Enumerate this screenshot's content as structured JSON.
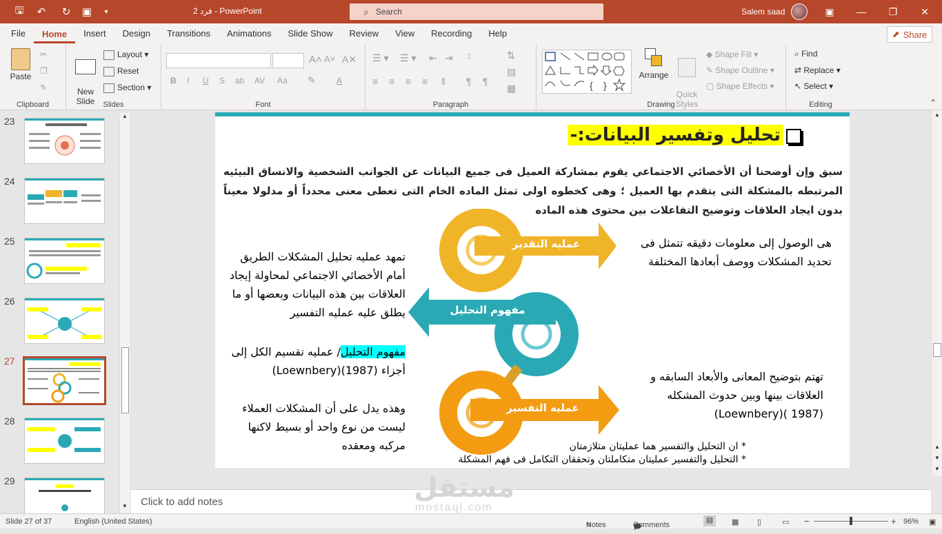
{
  "titlebar": {
    "doc_title": "فرد 2  -  PowerPoint",
    "search_label": "Search",
    "user_name": "Salem saad"
  },
  "tabs": [
    "File",
    "Home",
    "Insert",
    "Design",
    "Transitions",
    "Animations",
    "Slide Show",
    "Review",
    "View",
    "Recording",
    "Help"
  ],
  "active_tab": "Home",
  "share_label": "Share",
  "ribbon": {
    "clipboard": {
      "label": "Clipboard",
      "paste": "Paste"
    },
    "slides": {
      "label": "Slides",
      "new_slide": "New\nSlide",
      "layout": "Layout",
      "reset": "Reset",
      "section": "Section"
    },
    "font": {
      "label": "Font",
      "buttons": [
        "B",
        "I",
        "U",
        "S",
        "ab",
        "AV",
        "Aa",
        "A"
      ]
    },
    "paragraph": {
      "label": "Paragraph"
    },
    "drawing": {
      "label": "Drawing",
      "arrange": "Arrange",
      "quick_styles": "Quick\nStyles",
      "shape_fill": "Shape Fill",
      "shape_outline": "Shape Outline",
      "shape_effects": "Shape Effects"
    },
    "editing": {
      "label": "Editing",
      "find": "Find",
      "replace": "Replace",
      "select": "Select"
    }
  },
  "thumbnails": [
    {
      "num": "23",
      "selected": false
    },
    {
      "num": "24",
      "selected": false
    },
    {
      "num": "25",
      "selected": false
    },
    {
      "num": "26",
      "selected": false
    },
    {
      "num": "27",
      "selected": true
    },
    {
      "num": "28",
      "selected": false
    },
    {
      "num": "29",
      "selected": false
    }
  ],
  "slide": {
    "title": "تحليل وتفسير البيانات:-",
    "paragraph": "سبق وإن أوضحنا أن الأخصائي الاجتماعي يقوم بمشاركة العميل فى جميع البيانات عن الجوانب الشخصية والانساق البيئيه المرتبطه بالمشكلة التى يتقدم بها العميل ؛ وهى كخطوه اولى تمثل الماده الخام التى تعطى معنى محدداً أو مدلولا معيناً بدون ايجاد العلاقات وتوضيح التفاعلات بين محتوى هذه الماده",
    "arrow1": "عمليه التقدير",
    "arrow2": "مفهوم التحليل",
    "arrow3": "عمليه التفسير",
    "right_top": "هى الوصول إلى معلومات دقيقه تتمثل فى تحديد المشكلات ووصف أبعادها المختلفة",
    "left_top": "تمهد عمليه تحليل المشكلات الطريق أمام الأخصائي الاجتماعي لمحاولة إيجاد العلاقات بين هذه البيانات وبعضها أو ما يطلق عليه عمليه التفسير",
    "left_mid_hl": "مفهوم التحليل",
    "left_mid_rest": "/ عمليه تقسيم الكل إلى أجزاء (1987)(Loewnbery)",
    "left_bottom": "وهذه يدل على أن المشكلات العملاء ليست من نوع واحد أو بسيط لاكنها مركبه ومعقده",
    "right_bottom": "تهتم بتوضيح المعانى والأبعاد السابقه و العلاقات بينها وبين حدوث المشكله (1987 )(Loewnbery)",
    "note1": "* ان التحليل والتفسير  هما عمليتان متلازمتان",
    "note2": "* التحليل والتفسير  عمليتان متكاملتان وتحققان التكامل فى فهم المشكلة"
  },
  "notes_placeholder": "Click to add notes",
  "status": {
    "slide_info": "Slide 27 of 37",
    "language": "English (United States)",
    "notes": "Notes",
    "comments": "Comments",
    "zoom": "96%"
  },
  "watermark": {
    "arabic": "مستقل",
    "latin": "mostaql.com"
  },
  "colors": {
    "accent": "#b7472a",
    "teal": "#2aa9b5",
    "gold": "#f0b429",
    "orange": "#f39c12",
    "highlight": "#ffff00"
  }
}
